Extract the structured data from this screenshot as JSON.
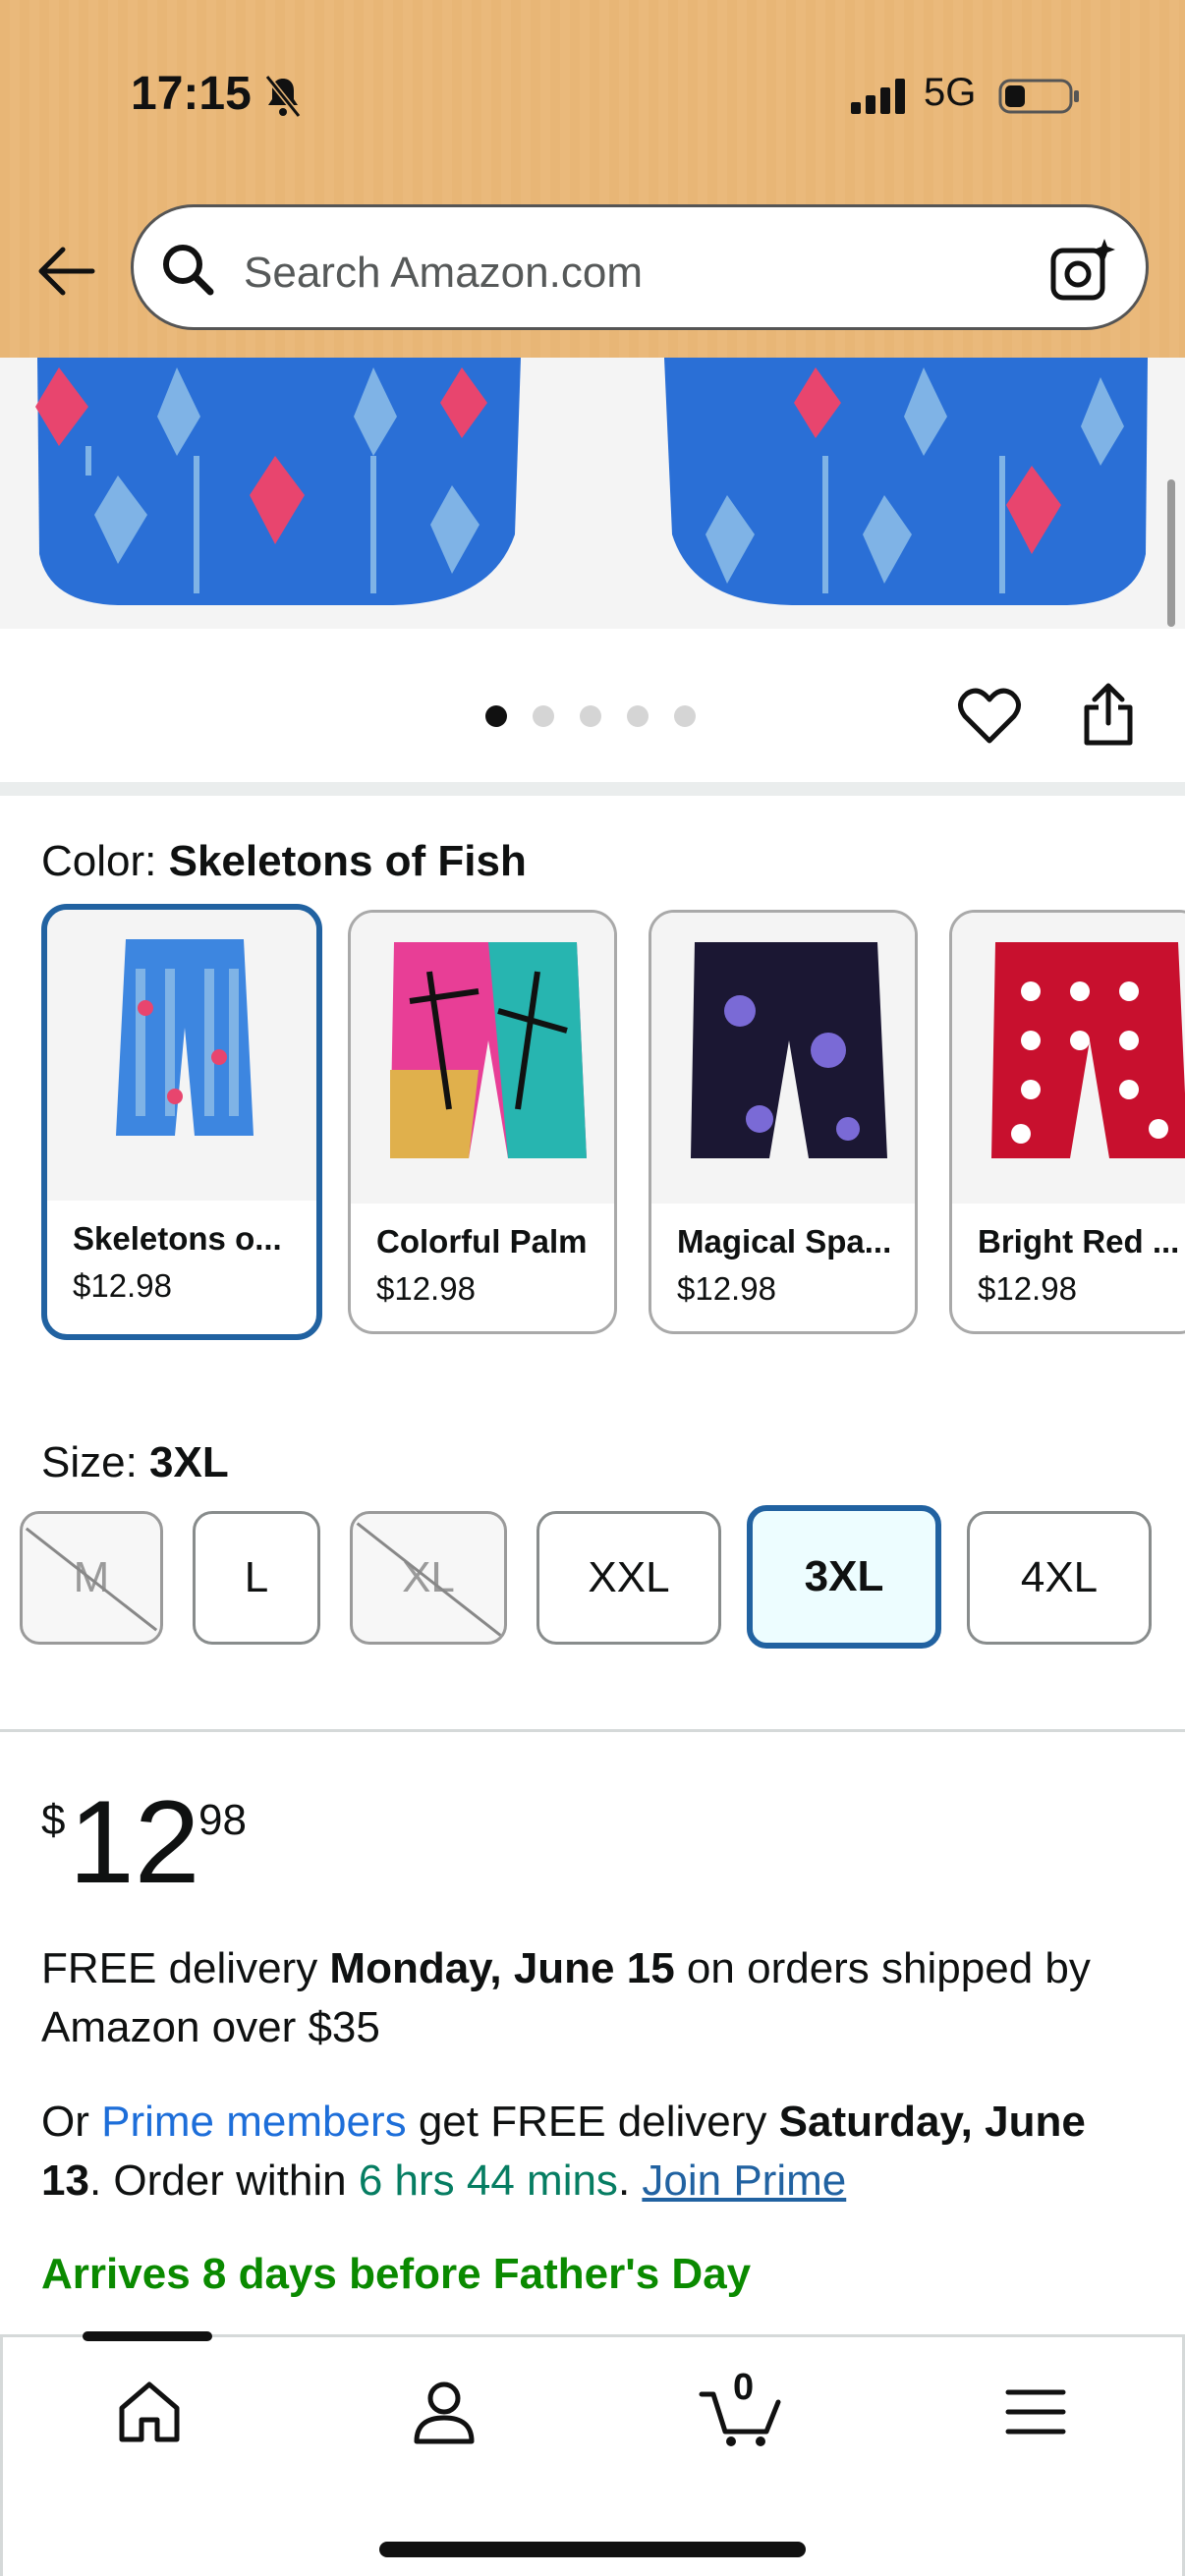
{
  "status_bar": {
    "time": "17:15",
    "network": "5G"
  },
  "search": {
    "placeholder": "Search Amazon.com"
  },
  "carousel": {
    "dot_count": 5,
    "active_index": 0
  },
  "color": {
    "label": "Color: ",
    "selected_value": "Skeletons of Fish",
    "options": [
      {
        "name": "Skeletons o...",
        "price": "$12.98",
        "selected": true
      },
      {
        "name": "Colorful Palm",
        "price": "$12.98",
        "selected": false
      },
      {
        "name": "Magical Spa...",
        "price": "$12.98",
        "selected": false
      },
      {
        "name": "Bright Red ...",
        "price": "$12.98",
        "selected": false
      }
    ]
  },
  "size": {
    "label": "Size: ",
    "selected_value": "3XL",
    "options": [
      {
        "label": "M",
        "available": false
      },
      {
        "label": "L",
        "available": true
      },
      {
        "label": "XL",
        "available": false
      },
      {
        "label": "XXL",
        "available": true
      },
      {
        "label": "3XL",
        "available": true,
        "selected": true
      },
      {
        "label": "4XL",
        "available": true
      }
    ]
  },
  "price": {
    "symbol": "$",
    "whole": "12",
    "fraction": "98"
  },
  "delivery": {
    "line1_a": "FREE delivery ",
    "line1_date": "Monday, June 15",
    "line1_b": " on orders shipped by Amazon over $35",
    "line2_a": "Or ",
    "line2_prime": "Prime members",
    "line2_b": " get FREE delivery ",
    "line2_date": "Saturday, June 13",
    "line2_c": ". Order within ",
    "line2_countdown": "6 hrs 44 mins",
    "line2_d": ". ",
    "line2_join": "Join Prime",
    "arrives": "Arrives 8 days before Father's Day"
  },
  "bottom_nav": {
    "cart_count": "0"
  },
  "colors": {
    "accent": "#2162a1",
    "link": "#1d6ed9",
    "green": "#0a8a00",
    "header": "#e8b676"
  }
}
